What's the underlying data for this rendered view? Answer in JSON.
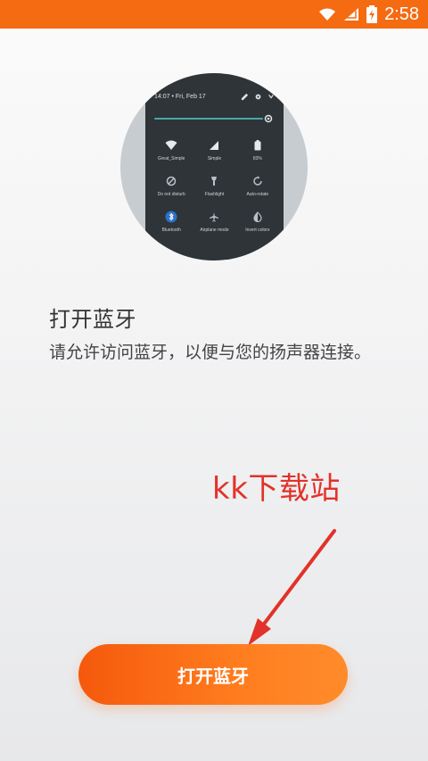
{
  "status_bar": {
    "time": "2:58",
    "icons": [
      "wifi-icon",
      "signal-icon",
      "battery-icon"
    ]
  },
  "illustration": {
    "phone_datetime": "14:07 • Fri, Feb 17",
    "header_icons": [
      "edit-icon",
      "settings-icon",
      "chevron-down-icon"
    ],
    "tiles": [
      {
        "icon": "wifi-icon",
        "label": "Great_Simple"
      },
      {
        "icon": "signal-icon",
        "label": "Simple"
      },
      {
        "icon": "battery-icon",
        "label": "83%"
      },
      {
        "icon": "do-not-disturb-icon",
        "label": "Do not disturb"
      },
      {
        "icon": "flashlight-icon",
        "label": "Flashlight"
      },
      {
        "icon": "auto-rotate-icon",
        "label": "Auto-rotate"
      },
      {
        "icon": "bluetooth-icon",
        "label": "Bluetooth"
      },
      {
        "icon": "airplane-icon",
        "label": "Airplane mode"
      },
      {
        "icon": "invert-colors-icon",
        "label": "Invert colors"
      }
    ]
  },
  "content": {
    "title": "打开蓝牙",
    "description": "请允许访问蓝牙，以便与您的扬声器连接。"
  },
  "watermark": {
    "text": "kk下载站"
  },
  "actions": {
    "primary_label": "打开蓝牙"
  },
  "colors": {
    "status_bar": "#f46b12",
    "primary_button_start": "#f5590c",
    "primary_button_end": "#ff8b2a",
    "watermark": "#e2322a"
  }
}
